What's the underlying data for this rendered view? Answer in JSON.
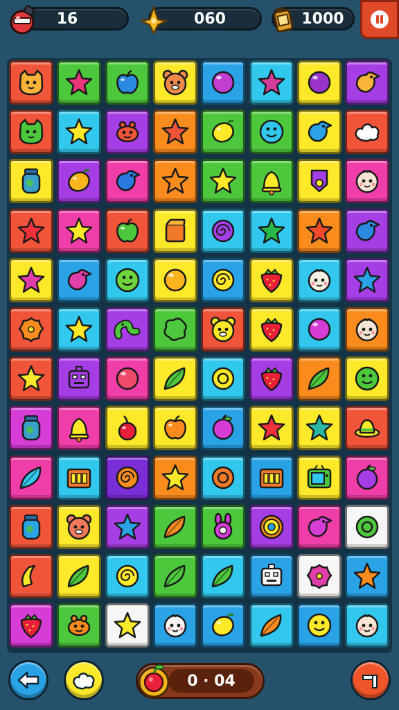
{
  "hud": {
    "moves_value": "16",
    "coins_value": "060",
    "score_value": "1000"
  },
  "bottom_bar": {
    "timer_value": "0 · 04"
  },
  "colors": {
    "red": "#f0553a",
    "orange": "#fa8c1e",
    "yellow": "#fde82a",
    "green": "#4dc83c",
    "cyan": "#32c8ee",
    "blue": "#2aa2e6",
    "purple": "#a63ee6",
    "pink": "#f03ea8",
    "magenta": "#d63cd6",
    "white": "#f6f6f6",
    "violet": "#7a2ed6"
  },
  "board": {
    "rows": [
      [
        {
          "bg": "red",
          "icon": "cat-face",
          "ic": "#fbb33a"
        },
        {
          "bg": "green",
          "icon": "star",
          "ic": "#e8367a"
        },
        {
          "bg": "green",
          "icon": "apple",
          "ic": "#2a8ae0"
        },
        {
          "bg": "yellow",
          "icon": "bear-face",
          "ic": "#f08a4a"
        },
        {
          "bg": "blue",
          "icon": "circle",
          "ic": "#c23ed0"
        },
        {
          "bg": "cyan",
          "icon": "star",
          "ic": "#d63c9c"
        },
        {
          "bg": "yellow",
          "icon": "circle",
          "ic": "#9a34c8"
        },
        {
          "bg": "purple",
          "icon": "bird",
          "ic": "#fbb33a"
        }
      ],
      [
        {
          "bg": "red",
          "icon": "cat-face",
          "ic": "#4dc83c"
        },
        {
          "bg": "cyan",
          "icon": "star",
          "ic": "#fde82a"
        },
        {
          "bg": "purple",
          "icon": "crab",
          "ic": "#f0553a"
        },
        {
          "bg": "orange",
          "icon": "star",
          "ic": "#f0553a"
        },
        {
          "bg": "green",
          "icon": "lemon",
          "ic": "#fde82a"
        },
        {
          "bg": "green",
          "icon": "smiley",
          "ic": "#32c8ee"
        },
        {
          "bg": "yellow",
          "icon": "bird",
          "ic": "#2aa2e6"
        },
        {
          "bg": "red",
          "icon": "cloud",
          "ic": "#ffffff"
        }
      ],
      [
        {
          "bg": "yellow",
          "icon": "jar",
          "ic": "#3aa0c8"
        },
        {
          "bg": "purple",
          "icon": "lemon",
          "ic": "#fbb31e"
        },
        {
          "bg": "pink",
          "icon": "bird",
          "ic": "#2a7ae0"
        },
        {
          "bg": "orange",
          "icon": "star",
          "ic": "#fa8c1e"
        },
        {
          "bg": "green",
          "icon": "star",
          "ic": "#fde82a"
        },
        {
          "bg": "green",
          "icon": "bell",
          "ic": "#fde82a"
        },
        {
          "bg": "yellow",
          "icon": "tag",
          "ic": "#a63ee6"
        },
        {
          "bg": "pink",
          "icon": "baby-face",
          "ic": "#f6e4d4"
        }
      ],
      [
        {
          "bg": "red",
          "icon": "star",
          "ic": "#f0303a"
        },
        {
          "bg": "pink",
          "icon": "star",
          "ic": "#fde82a"
        },
        {
          "bg": "red",
          "icon": "apple",
          "ic": "#4dc83c"
        },
        {
          "bg": "yellow",
          "icon": "box",
          "ic": "#f07a2a"
        },
        {
          "bg": "cyan",
          "icon": "swirl",
          "ic": "#a63ee6"
        },
        {
          "bg": "cyan",
          "icon": "star",
          "ic": "#2ab84a"
        },
        {
          "bg": "orange",
          "icon": "star",
          "ic": "#f04a2a"
        },
        {
          "bg": "purple",
          "icon": "bird",
          "ic": "#2a8ae0"
        }
      ],
      [
        {
          "bg": "yellow",
          "icon": "star",
          "ic": "#e03ea8"
        },
        {
          "bg": "blue",
          "icon": "bird",
          "ic": "#e03ea8"
        },
        {
          "bg": "cyan",
          "icon": "smiley",
          "ic": "#6ed63c"
        },
        {
          "bg": "yellow",
          "icon": "circle",
          "ic": "#fbb31e"
        },
        {
          "bg": "blue",
          "icon": "swirl",
          "ic": "#fde82a"
        },
        {
          "bg": "yellow",
          "icon": "strawberry",
          "ic": "#e8203a"
        },
        {
          "bg": "cyan",
          "icon": "baby-face",
          "ic": "#f6f0e4"
        },
        {
          "bg": "purple",
          "icon": "star",
          "ic": "#2aa2e6"
        }
      ],
      [
        {
          "bg": "red",
          "icon": "flower",
          "ic": "#fa8c1e"
        },
        {
          "bg": "cyan",
          "icon": "star",
          "ic": "#fde82a"
        },
        {
          "bg": "purple",
          "icon": "worm",
          "ic": "#4dc83c"
        },
        {
          "bg": "green",
          "icon": "blob",
          "ic": "#4dc83c"
        },
        {
          "bg": "red",
          "icon": "bear-face",
          "ic": "#fde82a"
        },
        {
          "bg": "yellow",
          "icon": "strawberry",
          "ic": "#e8203a"
        },
        {
          "bg": "cyan",
          "icon": "circle",
          "ic": "#d63cd6"
        },
        {
          "bg": "orange",
          "icon": "baby-face",
          "ic": "#f6e4d4"
        }
      ],
      [
        {
          "bg": "red",
          "icon": "star",
          "ic": "#fde82a"
        },
        {
          "bg": "purple",
          "icon": "robot",
          "ic": "#a63ee6"
        },
        {
          "bg": "pink",
          "icon": "circle",
          "ic": "#f04a6a"
        },
        {
          "bg": "yellow",
          "icon": "leaf",
          "ic": "#4dc83c"
        },
        {
          "bg": "cyan",
          "icon": "ring",
          "ic": "#fde82a"
        },
        {
          "bg": "purple",
          "icon": "strawberry",
          "ic": "#e8203a"
        },
        {
          "bg": "orange",
          "icon": "leaf",
          "ic": "#4dc83c"
        },
        {
          "bg": "yellow",
          "icon": "smiley",
          "ic": "#4dc83c"
        }
      ],
      [
        {
          "bg": "magenta",
          "icon": "jar",
          "ic": "#3aa0c8"
        },
        {
          "bg": "pink",
          "icon": "bell",
          "ic": "#fde82a"
        },
        {
          "bg": "yellow",
          "icon": "cherry",
          "ic": "#e8203a"
        },
        {
          "bg": "yellow",
          "icon": "apple",
          "ic": "#fa8c1e"
        },
        {
          "bg": "blue",
          "icon": "plum",
          "ic": "#d63cd6"
        },
        {
          "bg": "yellow",
          "icon": "star",
          "ic": "#f0303a"
        },
        {
          "bg": "yellow",
          "icon": "star",
          "ic": "#2ab8a0"
        },
        {
          "bg": "red",
          "icon": "hat",
          "ic": "#fde82a"
        }
      ],
      [
        {
          "bg": "pink",
          "icon": "leaf",
          "ic": "#32c8ee"
        },
        {
          "bg": "cyan",
          "icon": "crate",
          "ic": "#f07a2a"
        },
        {
          "bg": "violet",
          "icon": "swirl",
          "ic": "#fa8c1e"
        },
        {
          "bg": "orange",
          "icon": "star",
          "ic": "#fde82a"
        },
        {
          "bg": "cyan",
          "icon": "ring",
          "ic": "#f07a2a"
        },
        {
          "bg": "blue",
          "icon": "crate",
          "ic": "#f07a2a"
        },
        {
          "bg": "yellow",
          "icon": "tv",
          "ic": "#4dc83c"
        },
        {
          "bg": "pink",
          "icon": "plum",
          "ic": "#a63ee6"
        }
      ],
      [
        {
          "bg": "red",
          "icon": "jar",
          "ic": "#2aa2e6"
        },
        {
          "bg": "yellow",
          "icon": "bear-face",
          "ic": "#f07a5a"
        },
        {
          "bg": "purple",
          "icon": "star",
          "ic": "#2aa2e6"
        },
        {
          "bg": "green",
          "icon": "leaf",
          "ic": "#fa8c1e"
        },
        {
          "bg": "green",
          "icon": "bunny",
          "ic": "#d63cd6"
        },
        {
          "bg": "purple",
          "icon": "gear",
          "ic": "#fde82a"
        },
        {
          "bg": "pink",
          "icon": "bird",
          "ic": "#d63cd6"
        },
        {
          "bg": "white",
          "icon": "ring",
          "ic": "#4dc83c"
        }
      ],
      [
        {
          "bg": "red",
          "icon": "banana",
          "ic": "#fde82a"
        },
        {
          "bg": "yellow",
          "icon": "leaf",
          "ic": "#4dc83c"
        },
        {
          "bg": "cyan",
          "icon": "swirl",
          "ic": "#fde82a"
        },
        {
          "bg": "green",
          "icon": "leaf",
          "ic": "#4dc83c"
        },
        {
          "bg": "cyan",
          "icon": "leaf",
          "ic": "#4dc83c"
        },
        {
          "bg": "blue",
          "icon": "robot",
          "ic": "#f6f6f6"
        },
        {
          "bg": "white",
          "icon": "flower",
          "ic": "#e03ea8"
        },
        {
          "bg": "blue",
          "icon": "star",
          "ic": "#fa8c1e"
        }
      ],
      [
        {
          "bg": "magenta",
          "icon": "strawberry",
          "ic": "#e8203a"
        },
        {
          "bg": "green",
          "icon": "crab",
          "ic": "#fa8c1e"
        },
        {
          "bg": "white",
          "icon": "star",
          "ic": "#fde82a"
        },
        {
          "bg": "blue",
          "icon": "baby-face",
          "ic": "#f6f6f6"
        },
        {
          "bg": "blue",
          "icon": "lemon",
          "ic": "#fde82a"
        },
        {
          "bg": "cyan",
          "icon": "leaf",
          "ic": "#fa8c1e"
        },
        {
          "bg": "blue",
          "icon": "smiley",
          "ic": "#fde82a"
        },
        {
          "bg": "cyan",
          "icon": "baby-face",
          "ic": "#f6e4d4"
        }
      ]
    ]
  }
}
